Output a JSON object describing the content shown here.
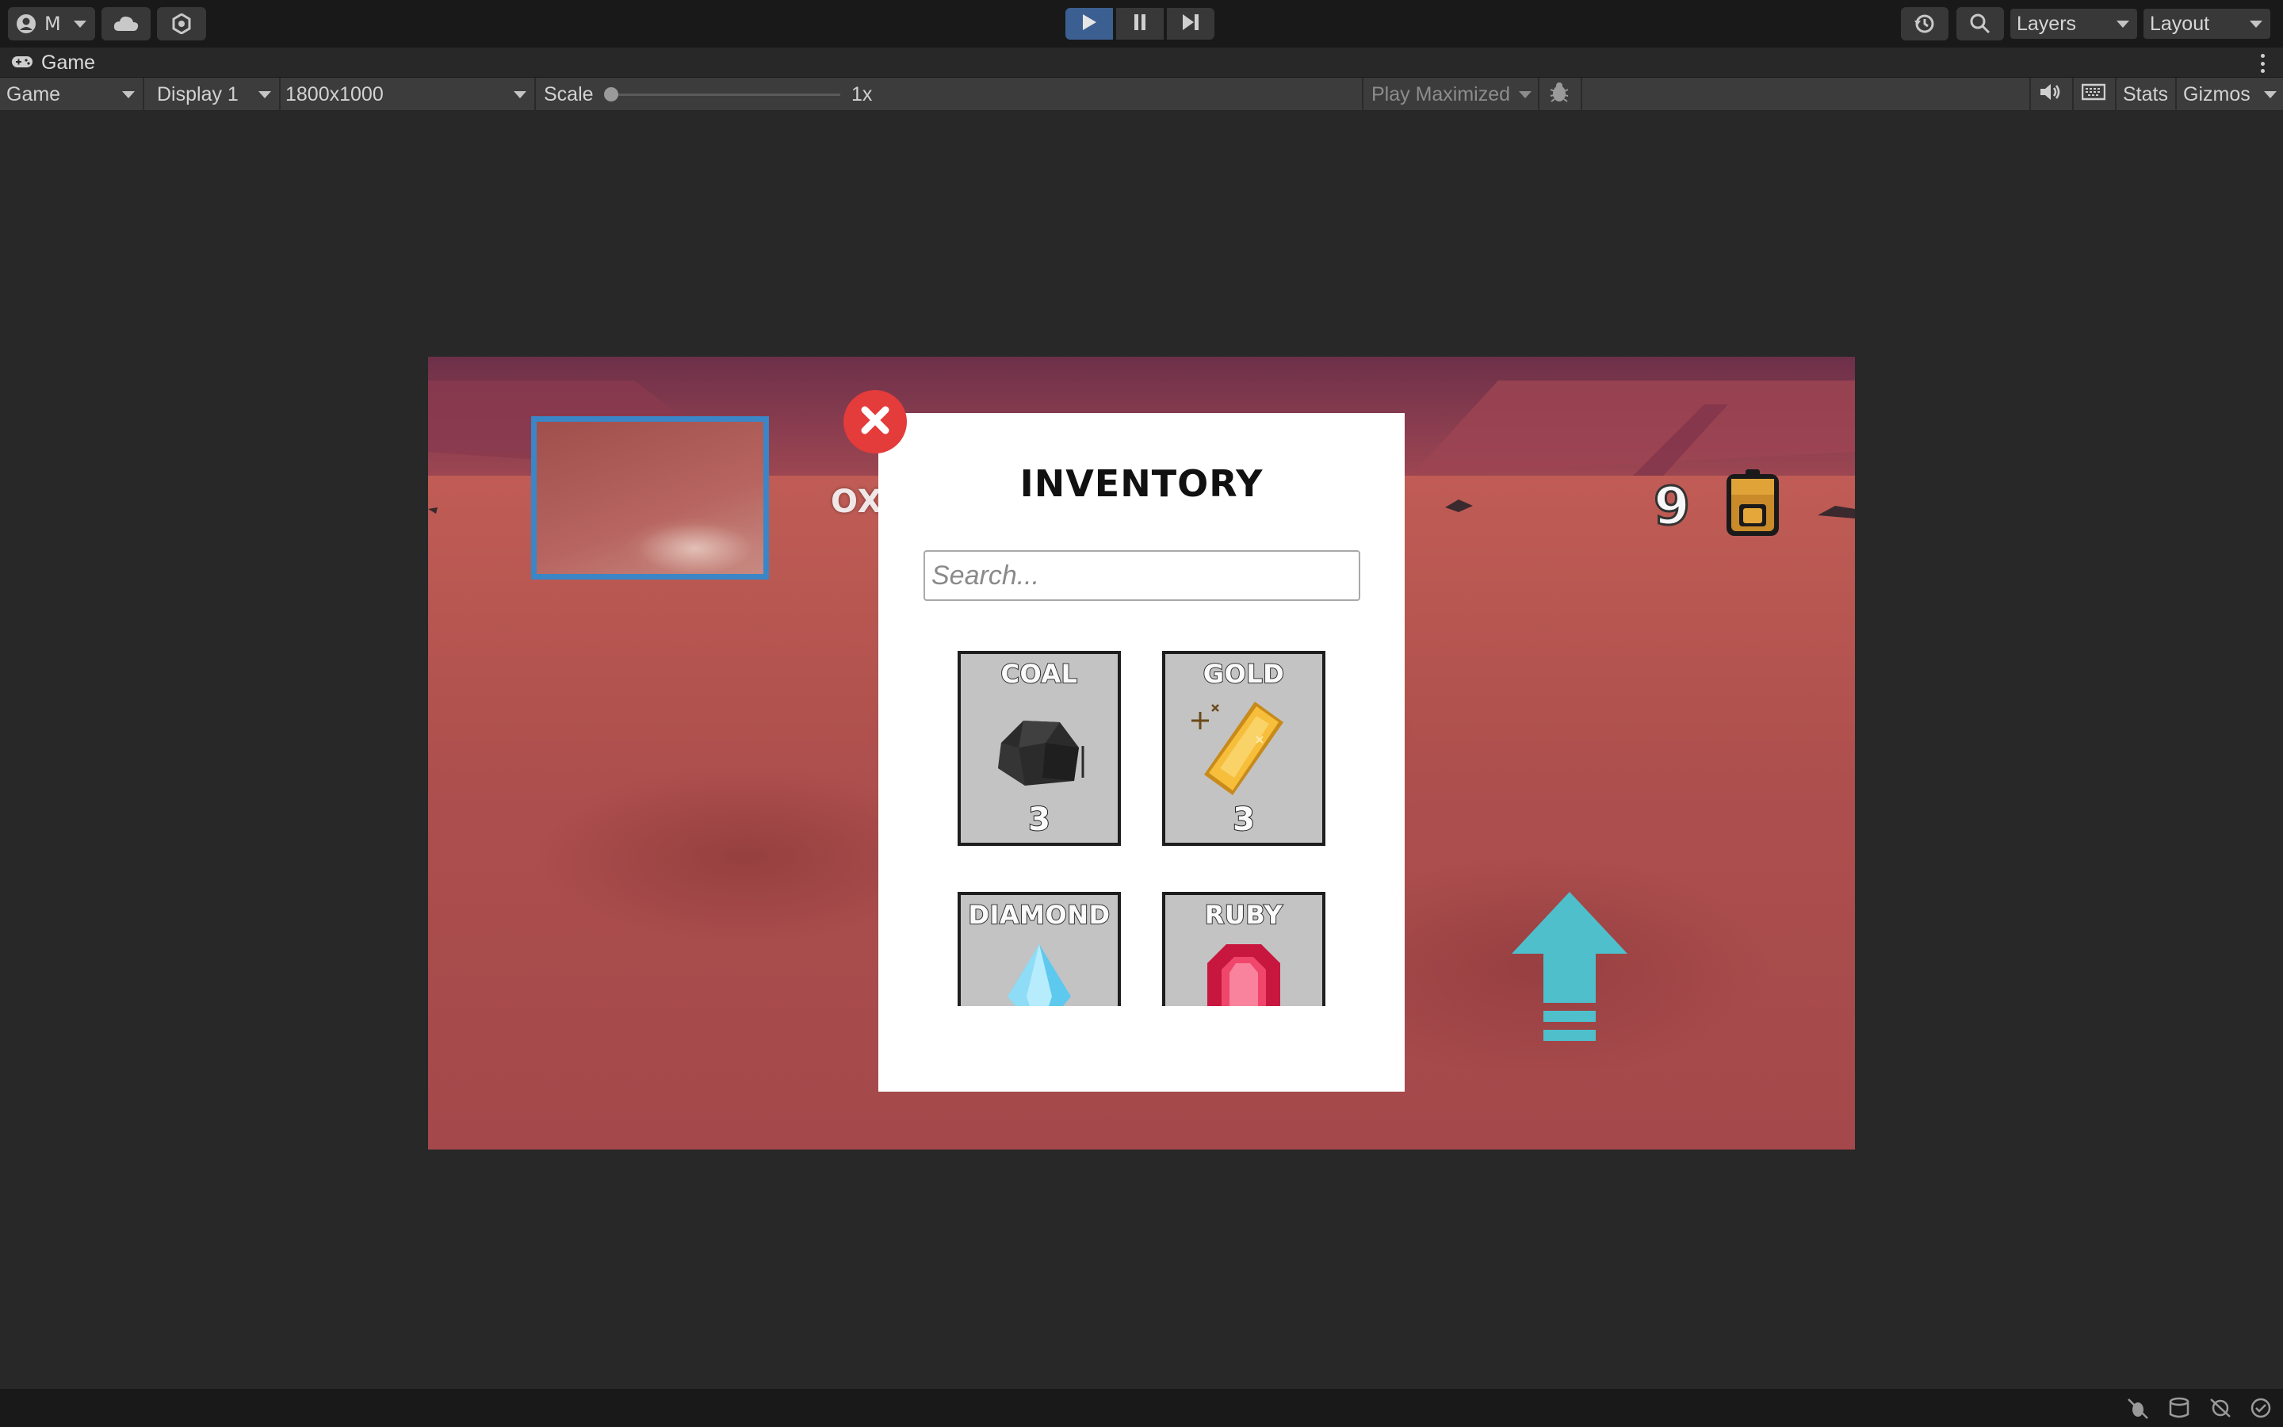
{
  "toolbar": {
    "account_label": "M",
    "layers_label": "Layers",
    "layout_label": "Layout"
  },
  "tab": {
    "title": "Game"
  },
  "gamebar": {
    "view_label": "Game",
    "display_label": "Display 1",
    "resolution_label": "1800x1000",
    "scale_label": "Scale",
    "scale_value": "1x",
    "scale_fraction": 0.0,
    "play_mode_label": "Play Maximized",
    "stats_label": "Stats",
    "gizmos_label": "Gizmos"
  },
  "hud": {
    "oxygen_label": "OXY",
    "item_count": "9"
  },
  "inventory": {
    "title": "INVENTORY",
    "search_placeholder": "Search...",
    "items": [
      {
        "name": "COAL",
        "count": "3",
        "icon": "coal-icon"
      },
      {
        "name": "GOLD",
        "count": "3",
        "icon": "gold-bar-icon"
      },
      {
        "name": "DIAMOND",
        "icon": "diamond-icon"
      },
      {
        "name": "RUBY",
        "icon": "ruby-icon"
      }
    ]
  },
  "colors": {
    "play_active": "#3c5f91",
    "close_button": "#e43b3b",
    "minimap_border": "#3a86c6",
    "arrow": "#4fbfcc"
  }
}
